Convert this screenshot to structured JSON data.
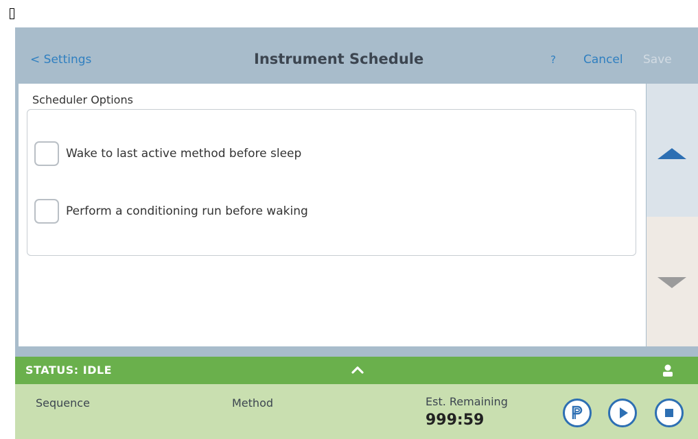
{
  "header": {
    "back_label": "< Settings",
    "title": "Instrument Schedule",
    "help_label": "?",
    "cancel_label": "Cancel",
    "save_label": "Save"
  },
  "scheduler": {
    "section_label": "Scheduler Options",
    "options": [
      {
        "label": "Wake to last active method before sleep",
        "checked": false
      },
      {
        "label": "Perform a conditioning run before waking",
        "checked": false
      }
    ]
  },
  "scroll": {
    "up_icon": "triangle-up-icon",
    "down_icon": "triangle-down-icon"
  },
  "status": {
    "text": "STATUS: IDLE",
    "expand_icon": "chevron-up-icon",
    "user_icon": "user-icon"
  },
  "bottom": {
    "sequence_label": "Sequence",
    "method_label": "Method",
    "est_remaining_label": "Est. Remaining",
    "est_remaining_value": "999:59",
    "buttons": [
      "prep-icon",
      "play-icon",
      "stop-icon"
    ]
  },
  "colors": {
    "header_bg": "#a8bccb",
    "accent_blue": "#2f7fc0",
    "status_green": "#6ab04c",
    "bottom_bg": "#c9dfb0"
  }
}
